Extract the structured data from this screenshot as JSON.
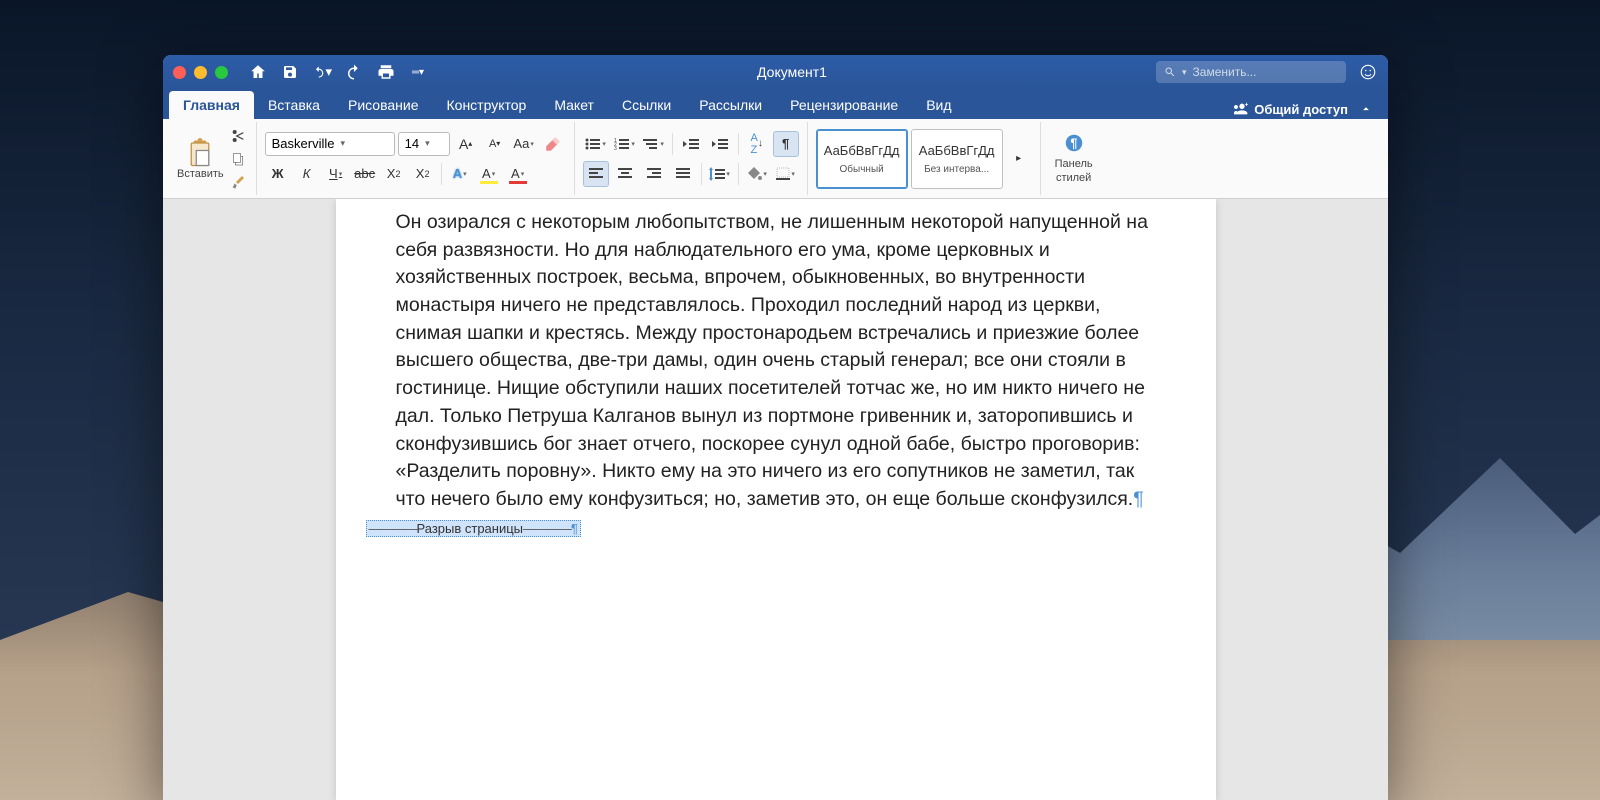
{
  "titlebar": {
    "document_title": "Документ1",
    "search_placeholder": "Заменить..."
  },
  "tabs": {
    "items": [
      "Главная",
      "Вставка",
      "Рисование",
      "Конструктор",
      "Макет",
      "Ссылки",
      "Рассылки",
      "Рецензирование",
      "Вид"
    ],
    "active_index": 0,
    "share_label": "Общий доступ"
  },
  "ribbon": {
    "paste_label": "Вставить",
    "font_name": "Baskerville",
    "font_size": "14",
    "bold": "Ж",
    "italic": "К",
    "underline": "Ч",
    "strike": "abc",
    "subscript": "X₂",
    "superscript": "X²",
    "font_effects": "A",
    "highlight": "A",
    "font_color": "A",
    "styles": {
      "normal_preview": "АаБбВвГгДд",
      "normal_label": "Обычный",
      "nospace_preview": "АаБбВвГгДд",
      "nospace_label": "Без интерва..."
    },
    "styles_panel_label": "Панель\nстилей",
    "pilcrow": "¶"
  },
  "document": {
    "body": "Он озирался с некоторым любопытством, не лишенным некоторой напущенной на себя развязности. Но для наблюдательного его ума, кроме церковных и хозяйственных построек, весьма, впрочем, обыкновенных, во внутренности монастыря ничего не представлялось. Проходил последний народ из церкви, снимая шапки и крестясь. Между простонародьем встречались и приезжие более высшего общества, две-три дамы, один очень старый генерал; все они стояли в гостинице. Нищие обступили наших посетителей тотчас же, но им никто ничего не дал. Только Петруша Калганов вынул из портмоне гривенник и, заторопившись и сконфузившись бог знает отчего, поскорее сунул одной бабе, быстро проговорив: «Разделить поровну». Никто ему на это ничего из его сопутников не заметил, так что нечего было ему конфузиться; но, заметив это, он еще больше сконфузился.",
    "pagebreak_label": "Разрыв страницы",
    "pilcrow": "¶"
  }
}
